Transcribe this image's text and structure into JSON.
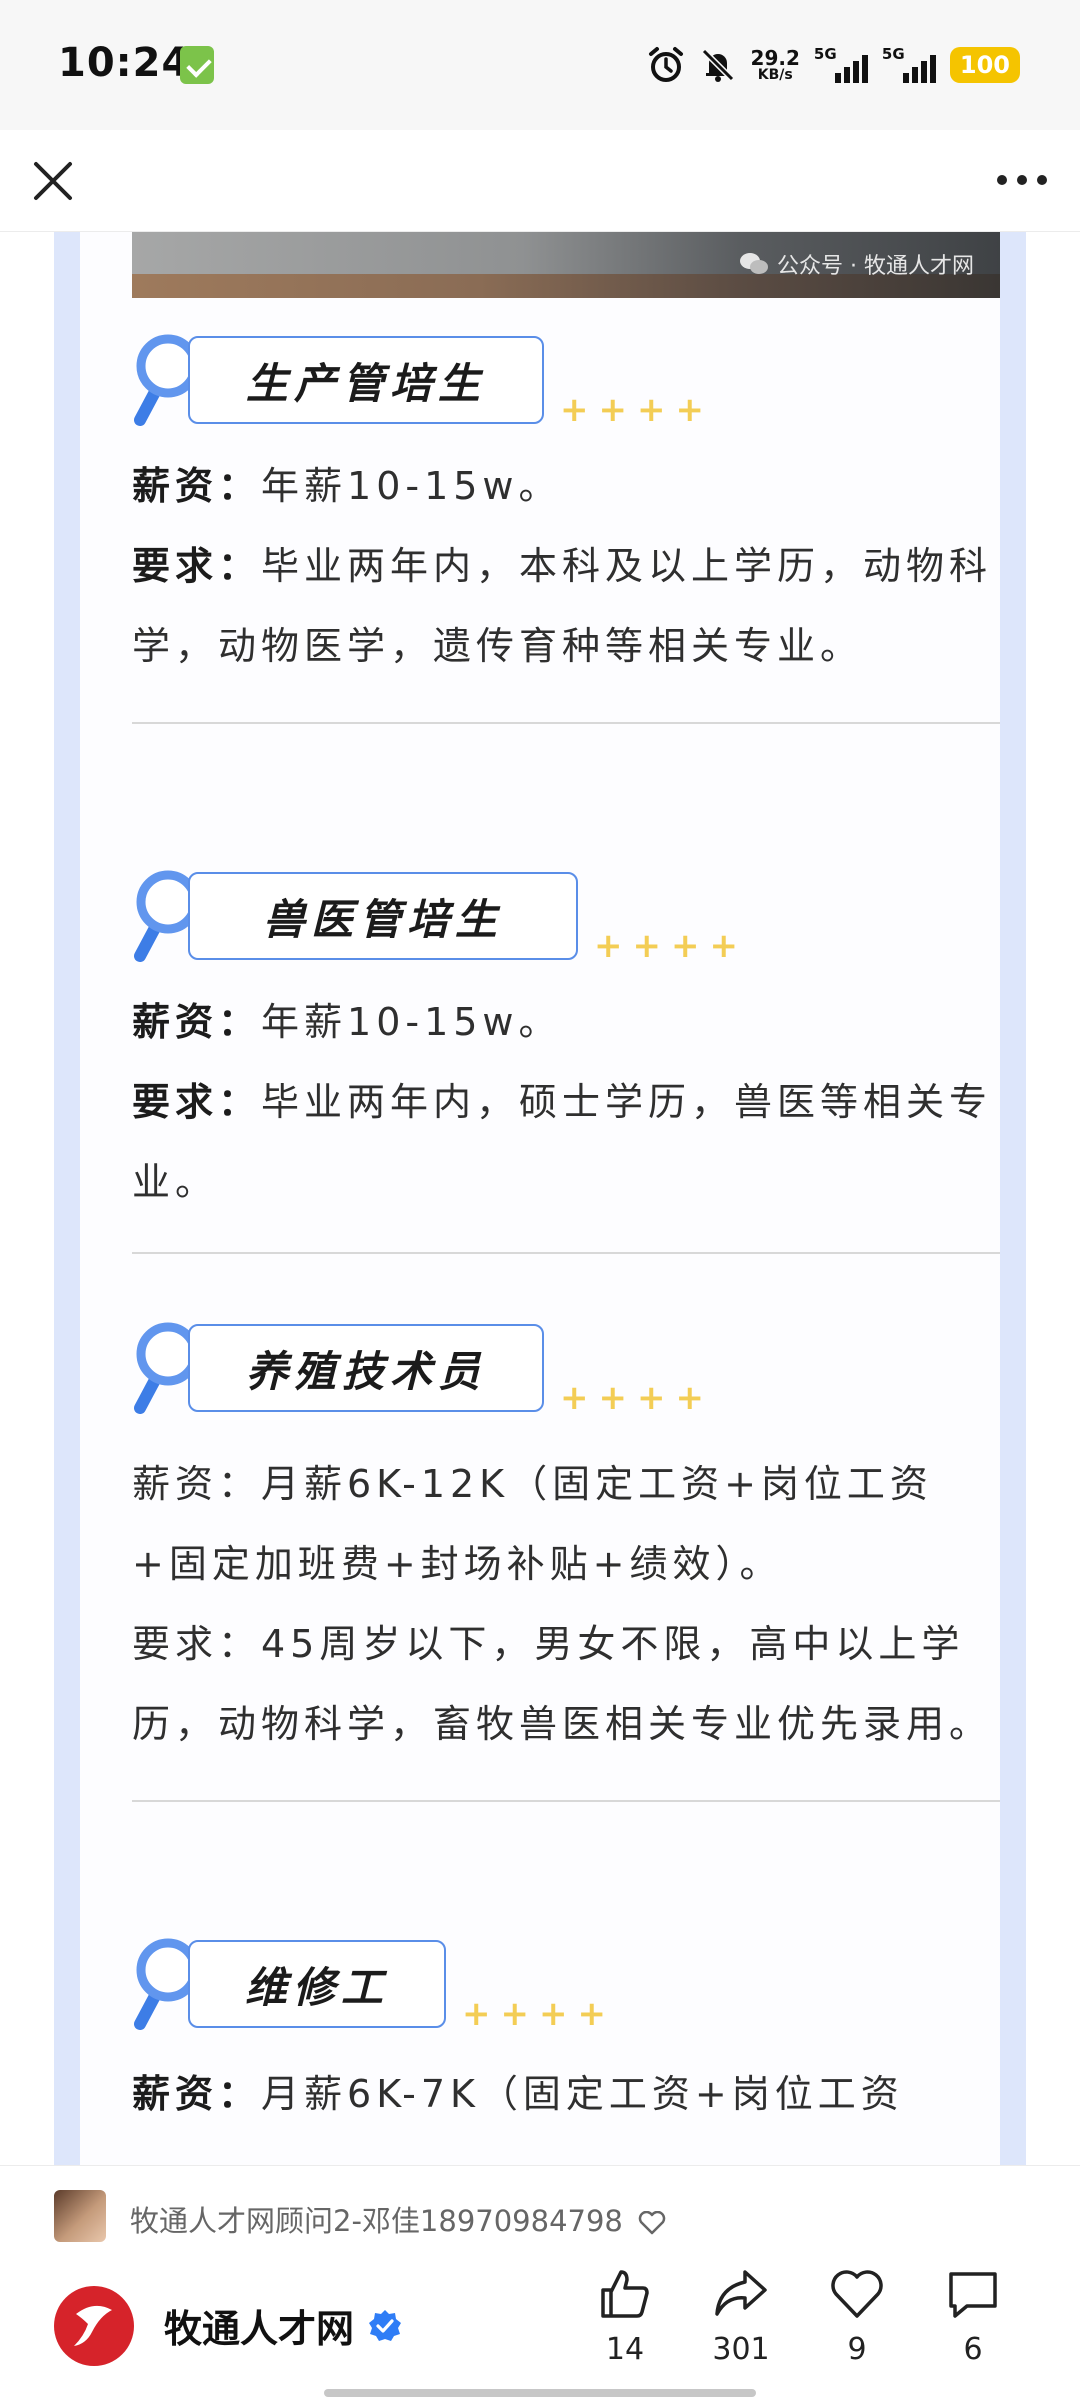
{
  "status_bar": {
    "time": "10:24",
    "net_speed_value": "29.2",
    "net_speed_unit": "KB/s",
    "sim1_label": "5G",
    "sim2_label": "5G",
    "battery": "100",
    "colors": {
      "battery": "#f5c400",
      "app_badge": "#7cc34a"
    }
  },
  "nav": {
    "close_icon": "close-icon",
    "more_icon": "more-icon"
  },
  "article": {
    "image_watermark": "公众号 · 牧通人才网",
    "stars": "++++",
    "sections": [
      {
        "title": "生产管培生",
        "salary_label": "薪资：",
        "salary_text": "年薪10-15w。",
        "req_label": "要求：",
        "req_text": "毕业两年内，本科及以上学历，动物科学，动物医学，遗传育种等相关专业。"
      },
      {
        "title": "兽医管培生",
        "salary_label": "薪资：",
        "salary_text": "年薪10-15w。",
        "req_label": "要求：",
        "req_text": "毕业两年内，硕士学历，兽医等相关专业。"
      },
      {
        "title": "养殖技术员",
        "salary_text": "薪资：月薪6K-12K（固定工资+岗位工资+固定加班费+封场补贴+绩效）。",
        "req_text": "要求：45周岁以下，男女不限，高中以上学历，动物科学，畜牧兽医相关专业优先录用。"
      },
      {
        "title": "维修工",
        "salary_label": "薪资：",
        "salary_text": "月薪6K-7K（固定工资+岗位工资"
      }
    ],
    "colors": {
      "accent_blue": "#5a8ee8",
      "star_yellow": "#f3cd55",
      "frame_blue": "#dde6fb"
    }
  },
  "bottom": {
    "advisor": "牧通人才网顾问2-邓佳18970984798",
    "account_name": "牧通人才网",
    "actions": [
      {
        "icon": "thumbs-up-icon",
        "count": "14"
      },
      {
        "icon": "share-icon",
        "count": "301"
      },
      {
        "icon": "heart-icon",
        "count": "9"
      },
      {
        "icon": "comment-icon",
        "count": "6"
      }
    ]
  }
}
